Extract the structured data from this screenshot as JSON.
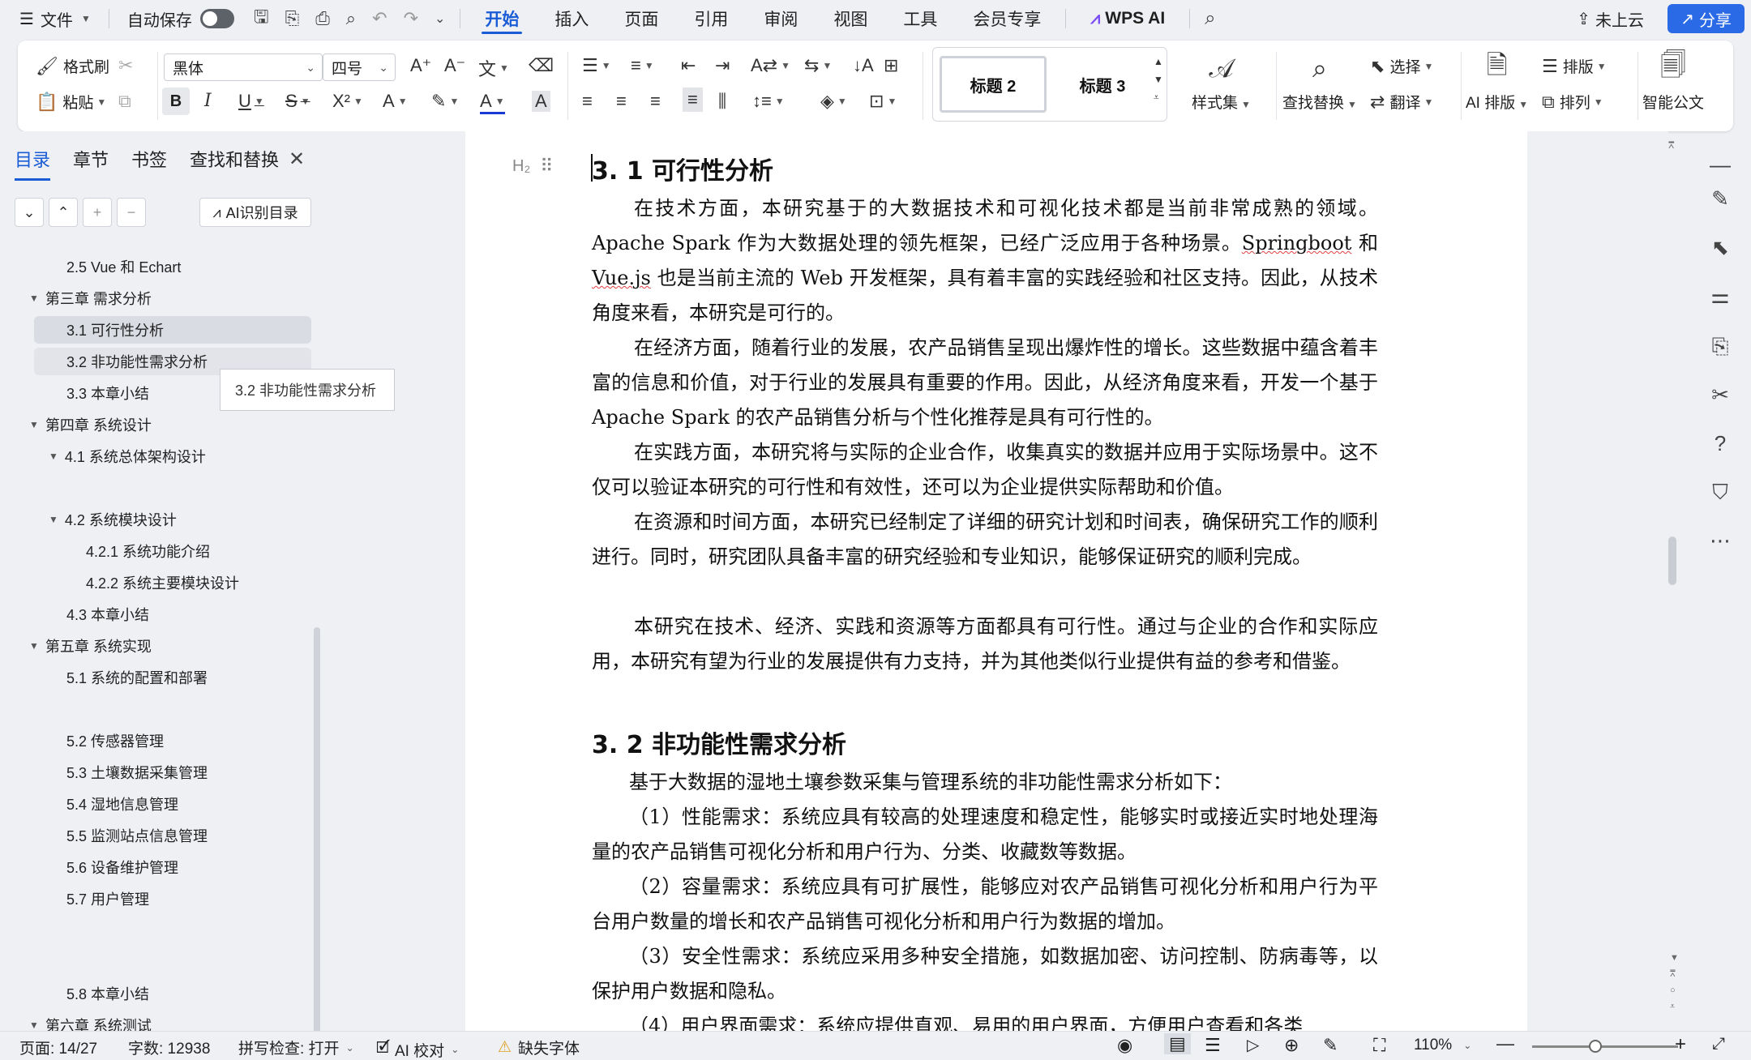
{
  "menu": {
    "hamburger": "☰",
    "file": "文件",
    "autosave": "自动保存",
    "tabs": [
      "开始",
      "插入",
      "页面",
      "引用",
      "审阅",
      "视图",
      "工具",
      "会员专享"
    ],
    "wps_ai": "WPS AI",
    "cloud": "未上云",
    "share": "分享"
  },
  "ribbon": {
    "format_painter": "格式刷",
    "paste": "粘贴",
    "font_name": "黑体",
    "font_size": "四号",
    "styles": [
      "标题 2",
      "标题 3"
    ],
    "style_set": "样式集",
    "find_replace": "查找替换",
    "select": "选择",
    "translate": "翻译",
    "ai_layout": "AI 排版",
    "arrange": "排版",
    "sort": "排列",
    "smart_doc": "智能公文"
  },
  "left_pane": {
    "tabs": [
      "目录",
      "章节",
      "书签",
      "查找和替换"
    ],
    "ai_toc": "AI识别目录",
    "tooltip": "3.2 非功能性需求分析",
    "toc": [
      {
        "label": "2.5 Vue 和 Echart"
      },
      {
        "label": "第三章  需求分析"
      },
      {
        "label": "3.1 可行性分析"
      },
      {
        "label": "3.2  非功能性需求分析"
      },
      {
        "label": "3.3 本章小结"
      },
      {
        "label": "第四章  系统设计"
      },
      {
        "label": "4.1  系统总体架构设计"
      },
      {
        "label": "4.2  系统模块设计"
      },
      {
        "label": "4.2.1 系统功能介绍"
      },
      {
        "label": "4.2.2 系统主要模块设计"
      },
      {
        "label": "4.3  本章小结"
      },
      {
        "label": "第五章  系统实现"
      },
      {
        "label": "5.1  系统的配置和部署"
      },
      {
        "label": "5.2  传感器管理"
      },
      {
        "label": "5.3  土壤数据采集管理"
      },
      {
        "label": "5.4  湿地信息管理"
      },
      {
        "label": "5.5  监测站点信息管理"
      },
      {
        "label": "5.6  设备维护管理"
      },
      {
        "label": "5.7  用户管理"
      },
      {
        "label": "5.8 本章小结"
      },
      {
        "label": "第六章  系统测试"
      }
    ]
  },
  "document": {
    "marker": "H₂",
    "heading1": "3. 1 可行性分析",
    "p1": [
      "在技术方面，本研究基于的大数据技术和可视化技术都是当前非常成熟的领域。Apache Spark 作为大数据处理的领先框架，已经广泛应用于各种场景。",
      "Springboot",
      " 和 ",
      "Vue.js",
      " 也是当前主流的 Web 开发框架，具有着丰富的实践经验和社区支持。因此，从技术角度来看，本研究是可行的。"
    ],
    "p2": "在经济方面，随着行业的发展，农产品销售呈现出爆炸性的增长。这些数据中蕴含着丰富的信息和价值，对于行业的发展具有重要的作用。因此，从经济角度来看，开发一个基于 Apache Spark 的农产品销售分析与个性化推荐是具有可行性的。",
    "p3": "在实践方面，本研究将与实际的企业合作，收集真实的数据并应用于实际场景中。这不仅可以验证本研究的可行性和有效性，还可以为企业提供实际帮助和价值。",
    "p4": "在资源和时间方面，本研究已经制定了详细的研究计划和时间表，确保研究工作的顺利进行。同时，研究团队具备丰富的研究经验和专业知识，能够保证研究的顺利完成。",
    "p5": "本研究在技术、经济、实践和资源等方面都具有可行性。通过与企业的合作和实际应用，本研究有望为行业的发展提供有力支持，并为其他类似行业提供有益的参考和借鉴。",
    "heading2": "3. 2  非功能性需求分析",
    "p6": "基于大数据的湿地土壤参数采集与管理系统的非功能性需求分析如下：",
    "p7": "（1）性能需求：系统应具有较高的处理速度和稳定性，能够实时或接近实时地处理海量的农产品销售可视化分析和用户行为、分类、收藏数等数据。",
    "p8": "（2）容量需求：系统应具有可扩展性，能够应对农产品销售可视化分析和用户行为平台用户数量的增长和农产品销售可视化分析和用户行为数据的增加。",
    "p9": "（3）安全性需求：系统应采用多种安全措施，如数据加密、访问控制、防病毒等，以保护用户数据和隐私。",
    "p10": "（4）用户界面需求：系统应提供直观、易用的用户界面，方便用户查看和各类"
  },
  "status": {
    "page": "页面: 14/27",
    "words": "字数: 12938",
    "spell": "拼写检查: 打开",
    "ai_check": "AI 校对",
    "missing_font": "缺失字体",
    "zoom": "110%"
  }
}
